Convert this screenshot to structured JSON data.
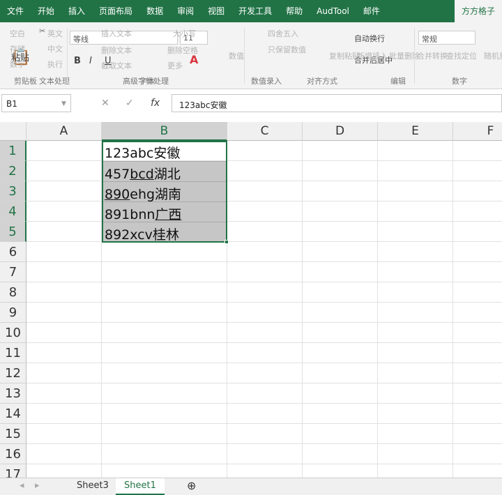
{
  "ribbon_tabs": [
    "文件",
    "开始",
    "插入",
    "页面布局",
    "数据",
    "审阅",
    "视图",
    "开发工具",
    "帮助",
    "AudTool",
    "邮件",
    "方方格子"
  ],
  "active_tab": "方方格子",
  "ribbon": {
    "paste": "粘贴",
    "cut_cn": "英文",
    "copy_cn": "中文",
    "exec": "执行",
    "blank": "空白",
    "save": "存储",
    "digits": "数字",
    "font_name": "等线",
    "font_size": "11",
    "bold": "B",
    "italic": "I",
    "underline": "U",
    "insert_text": "插入文本",
    "delete_text": "删除文本",
    "extract_text": "截取文本",
    "case": "大小写",
    "delete_space": "删除空格",
    "more": "更多",
    "numeric": "数值",
    "round": "四舍五入",
    "keep_value": "只保留数值",
    "wrap_text": "自动换行",
    "merge_center": "合并后居中",
    "number_format": "常规",
    "copy_paste": "复制粘贴",
    "new_insert": "新增插入",
    "batch_delete": "批量删除",
    "merge_convert": "合并转换",
    "find_locate": "查找定位",
    "random_repeat": "随机重复",
    "groups": {
      "clipboard": "剪贴板",
      "text_process": "文本处理",
      "font": "字体",
      "adv_font": "高级字体处理",
      "value_entry": "数值录入",
      "alignment": "对齐方式",
      "edit": "编辑",
      "number": "数字"
    }
  },
  "formula_bar": {
    "name_box": "B1",
    "cancel": "✕",
    "enter": "✓",
    "fx": "fx",
    "content": "123abc安徽"
  },
  "columns": [
    "A",
    "B",
    "C",
    "D",
    "E",
    "F"
  ],
  "selected_column": "B",
  "rows": [
    "1",
    "2",
    "3",
    "4",
    "5",
    "6",
    "7",
    "8",
    "9",
    "10",
    "11",
    "12",
    "13",
    "14",
    "15",
    "16",
    "17"
  ],
  "cells": [
    {
      "ref": "B1",
      "parts": [
        {
          "t": "123abc安徽",
          "u": false
        }
      ]
    },
    {
      "ref": "B2",
      "parts": [
        {
          "t": "457",
          "u": false
        },
        {
          "t": "bcd",
          "u": true
        },
        {
          "t": "湖北",
          "u": false
        }
      ]
    },
    {
      "ref": "B3",
      "parts": [
        {
          "t": "890",
          "u": true
        },
        {
          "t": "ehg湖南",
          "u": false
        }
      ]
    },
    {
      "ref": "B4",
      "parts": [
        {
          "t": "891bnn",
          "u": false
        },
        {
          "t": "广西",
          "u": true
        }
      ]
    },
    {
      "ref": "B5",
      "parts": [
        {
          "t": "892xcv桂林",
          "u": false
        }
      ]
    }
  ],
  "sheets": [
    "Sheet3",
    "Sheet1"
  ],
  "active_sheet": "Sheet1",
  "add_sheet": "⊕",
  "colors": {
    "accent": "#217346",
    "selection": "#c6c6c6"
  }
}
